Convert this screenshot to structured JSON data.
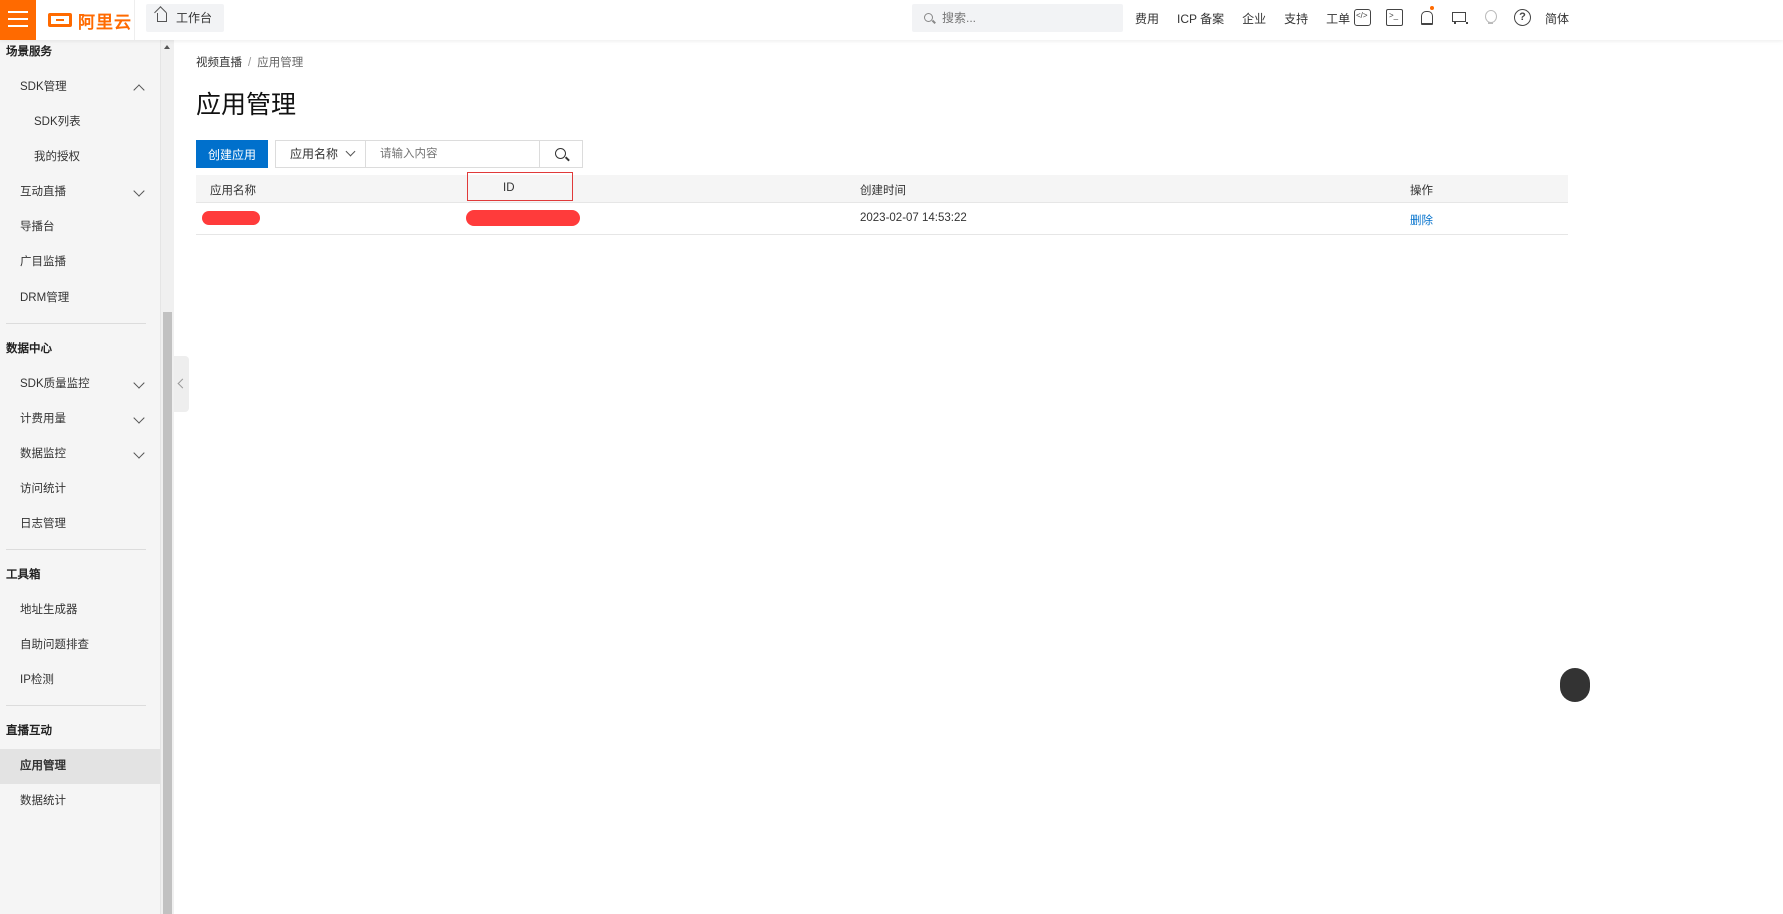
{
  "header": {
    "logo_text": "阿里云",
    "workbench_label": "工作台",
    "search_placeholder": "搜索...",
    "nav_links": [
      "费用",
      "ICP 备案",
      "企业",
      "支持",
      "工单"
    ],
    "lang": "简体",
    "accent_color": "#ff6a00",
    "icons": [
      "code-icon",
      "terminal-icon",
      "bell-icon",
      "cart-icon",
      "bulb-icon",
      "help-icon"
    ]
  },
  "sidebar": {
    "items": [
      {
        "label": "场景服务",
        "type": "group"
      },
      {
        "label": "SDK管理",
        "type": "l1",
        "expanded": true
      },
      {
        "label": "SDK列表",
        "type": "l2"
      },
      {
        "label": "我的授权",
        "type": "l2"
      },
      {
        "label": "互动直播",
        "type": "l1",
        "expanded": false
      },
      {
        "label": "导播台",
        "type": "l1"
      },
      {
        "label": "广目监播",
        "type": "l1"
      },
      {
        "label": "DRM管理",
        "type": "l1"
      },
      {
        "label": "数据中心",
        "type": "group"
      },
      {
        "label": "SDK质量监控",
        "type": "l1",
        "expanded": false
      },
      {
        "label": "计费用量",
        "type": "l1",
        "expanded": false
      },
      {
        "label": "数据监控",
        "type": "l1",
        "expanded": false
      },
      {
        "label": "访问统计",
        "type": "l1"
      },
      {
        "label": "日志管理",
        "type": "l1"
      },
      {
        "label": "工具箱",
        "type": "group"
      },
      {
        "label": "地址生成器",
        "type": "l1"
      },
      {
        "label": "自助问题排查",
        "type": "l1"
      },
      {
        "label": "IP检测",
        "type": "l1"
      },
      {
        "label": "直播互动",
        "type": "group"
      },
      {
        "label": "应用管理",
        "type": "l1",
        "active": true
      },
      {
        "label": "数据统计",
        "type": "l1"
      }
    ]
  },
  "main": {
    "breadcrumb": [
      "视频直播",
      "应用管理"
    ],
    "breadcrumb_sep": "/",
    "title": "应用管理",
    "create_button": "创建应用",
    "filter_select": "应用名称",
    "filter_placeholder": "请输入内容",
    "primary_color": "#0070cc",
    "table": {
      "columns": [
        "应用名称",
        "ID",
        "创建时间",
        "操作"
      ],
      "rows": [
        {
          "name": "",
          "id": "",
          "created": "2023-02-07 14:53:22",
          "action": "删除"
        }
      ]
    }
  }
}
